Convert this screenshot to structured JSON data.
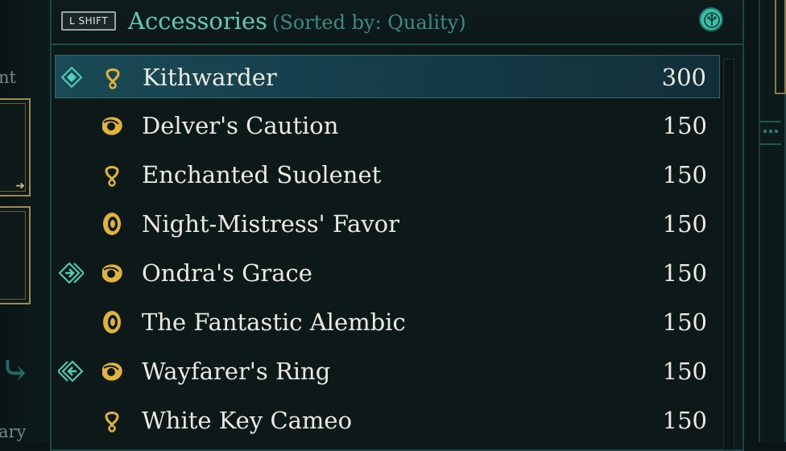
{
  "left_panel": {
    "text_top": "nt",
    "text_bottom": "ary"
  },
  "header": {
    "key_hint": "L SHIFT",
    "title": "Accessories",
    "sort_label": "(Sorted by: Quality)",
    "filter_icon": "tree-emblem-icon"
  },
  "items": [
    {
      "name": "Kithwarder",
      "value": "300",
      "icon": "amulet-icon",
      "status": "equipped-diamond-icon",
      "selected": true
    },
    {
      "name": "Delver's Caution",
      "value": "150",
      "icon": "ring-icon",
      "status": "",
      "selected": false
    },
    {
      "name": "Enchanted Suolenet",
      "value": "150",
      "icon": "amulet-icon",
      "status": "",
      "selected": false
    },
    {
      "name": "Night-Mistress' Favor",
      "value": "150",
      "icon": "band-icon",
      "status": "",
      "selected": false
    },
    {
      "name": "Ondra's Grace",
      "value": "150",
      "icon": "ring-icon",
      "status": "equip-right-icon",
      "selected": false
    },
    {
      "name": "The Fantastic Alembic",
      "value": "150",
      "icon": "band-icon",
      "status": "",
      "selected": false
    },
    {
      "name": "Wayfarer's Ring",
      "value": "150",
      "icon": "ring-icon",
      "status": "equip-left-icon",
      "selected": false
    },
    {
      "name": "White Key Cameo",
      "value": "150",
      "icon": "amulet-icon",
      "status": "",
      "selected": false
    }
  ],
  "colors": {
    "accent": "#5fcab7",
    "gold": "#e2b23b",
    "text": "#ecebe3",
    "selected_bg": "#1a4a55"
  }
}
